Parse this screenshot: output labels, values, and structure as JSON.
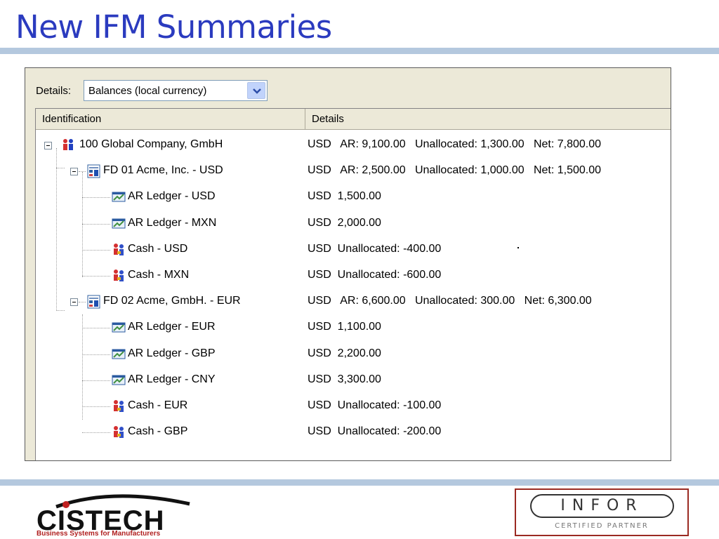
{
  "slide": {
    "title": "New IFM Summaries"
  },
  "toolbar": {
    "details_label": "Details:",
    "details_select_value": "Balances (local currency)"
  },
  "columns": {
    "identification": "Identification",
    "details": "Details"
  },
  "tree": {
    "rows": [
      {
        "label": "100  Global Company, GmbH",
        "details": "USD   AR: 9,100.00   Unallocated: 1,300.00   Net: 7,800.00",
        "icon": "company-icon",
        "level": 0
      },
      {
        "label": "FD 01  Acme, Inc. - USD",
        "details": "USD   AR: 2,500.00   Unallocated: 1,000.00   Net: 1,500.00",
        "icon": "division-icon",
        "level": 1
      },
      {
        "label": "AR Ledger - USD",
        "details": "USD  1,500.00",
        "icon": "ledger-icon",
        "level": 2
      },
      {
        "label": "AR Ledger - MXN",
        "details": "USD  2,000.00",
        "icon": "ledger-icon",
        "level": 2
      },
      {
        "label": "Cash - USD",
        "details": "USD  Unallocated: -400.00",
        "icon": "cash-icon",
        "level": 2
      },
      {
        "label": "Cash - MXN",
        "details": "USD  Unallocated: -600.00",
        "icon": "cash-icon",
        "level": 2
      },
      {
        "label": "FD 02  Acme, GmbH. - EUR",
        "details": "USD   AR: 6,600.00   Unallocated: 300.00   Net: 6,300.00",
        "icon": "division-icon",
        "level": 1
      },
      {
        "label": "AR Ledger - EUR",
        "details": "USD  1,100.00",
        "icon": "ledger-icon",
        "level": 2
      },
      {
        "label": "AR Ledger - GBP",
        "details": "USD  2,200.00",
        "icon": "ledger-icon",
        "level": 2
      },
      {
        "label": "AR Ledger - CNY",
        "details": "USD  3,300.00",
        "icon": "ledger-icon",
        "level": 2
      },
      {
        "label": "Cash - EUR",
        "details": "USD  Unallocated: -100.00",
        "icon": "cash-icon",
        "level": 2
      },
      {
        "label": "Cash - GBP",
        "details": "USD  Unallocated: -200.00",
        "icon": "cash-icon",
        "level": 2
      }
    ]
  },
  "logos": {
    "left_name": "CISTECH",
    "left_tagline": "Business Systems for Manufacturers",
    "right_name": "INFOR",
    "right_tagline": "CERTIFIED PARTNER"
  },
  "colors": {
    "title": "#2b3bbf",
    "rule": "#b4c8de",
    "window_bg": "#ece9d8",
    "accent_red": "#9b2a22"
  }
}
